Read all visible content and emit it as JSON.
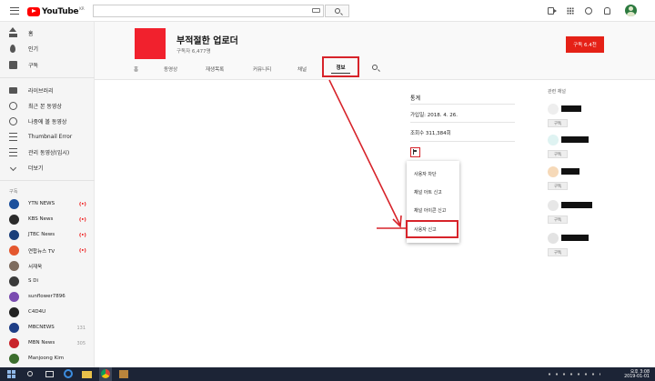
{
  "topbar": {
    "logo_text": "YouTube",
    "logo_region": "KR",
    "search_placeholder": ""
  },
  "sidebar": {
    "items": [
      {
        "label": "홈",
        "icon": "home-icon"
      },
      {
        "label": "인기",
        "icon": "fire-icon"
      },
      {
        "label": "구독",
        "icon": "subscriptions-icon"
      }
    ],
    "library": [
      {
        "label": "라이브러리",
        "icon": "folder-icon"
      },
      {
        "label": "최근 본 동영상",
        "icon": "history-icon"
      },
      {
        "label": "나중에 볼 동영상",
        "icon": "clock-icon"
      },
      {
        "label": "Thumbnail Error",
        "icon": "playlist-icon"
      },
      {
        "label": "관리 동영상(임시)",
        "icon": "playlist-icon"
      },
      {
        "label": "더보기",
        "icon": "chevron-down-icon"
      }
    ],
    "subscriptions_heading": "구독",
    "subscriptions": [
      {
        "name": "YTN NEWS",
        "badge": "(•)",
        "color": "#1a4f9c"
      },
      {
        "name": "KBS News",
        "badge": "(•)",
        "color": "#2b2b2b"
      },
      {
        "name": "JTBC News",
        "badge": "(•)",
        "color": "#1b3f7a"
      },
      {
        "name": "연합뉴스 TV",
        "badge": "(•)",
        "color": "#e4572e"
      },
      {
        "name": "서재욱",
        "badge": "",
        "color": "#7d6b5e"
      },
      {
        "name": "S Di",
        "badge": "",
        "color": "#3a3a3a"
      },
      {
        "name": "sunflower7896",
        "badge": "",
        "color": "#7a4bb0"
      },
      {
        "name": "C4D4U",
        "badge": "",
        "color": "#222222"
      },
      {
        "name": "MBCNEWS",
        "badge": "131",
        "color": "#1e3e86"
      },
      {
        "name": "MBN News",
        "badge": "305",
        "color": "#c9242b"
      },
      {
        "name": "Manjoong Kim",
        "badge": "",
        "color": "#3c6e2e"
      }
    ]
  },
  "channel": {
    "title": "부적절한 업로더",
    "subscribers": "구독자 6,477명",
    "subscribe_label": "구독 6.4천",
    "tabs": [
      "홈",
      "동영상",
      "재생목록",
      "커뮤니티",
      "채널"
    ],
    "active_tab": "정보"
  },
  "about": {
    "stats_heading": "통계",
    "joined": "가입일: 2018. 4. 26.",
    "views": "조회수 311,384회"
  },
  "report_menu": {
    "items": [
      "사용자 차단",
      "채널 아트 신고",
      "채널 아이콘 신고",
      "사용자 신고"
    ]
  },
  "related": {
    "heading": "관련 채널",
    "subscribe_label": "구독",
    "channels": [
      {
        "thumb": "#eeeeee",
        "width": 22
      },
      {
        "thumb": "#dff3f2",
        "width": 30
      },
      {
        "thumb": "#f6d9b8",
        "width": 20
      },
      {
        "thumb": "#e7e7e7",
        "width": 34
      },
      {
        "thumb": "#e3e3e3",
        "width": 30
      }
    ]
  },
  "taskbar": {
    "time": "오후 3:08",
    "date": "2019-01-01"
  },
  "colors": {
    "brand_red": "#ff0000",
    "subscribe_red": "#e52117",
    "highlight_red": "#d7232a"
  }
}
